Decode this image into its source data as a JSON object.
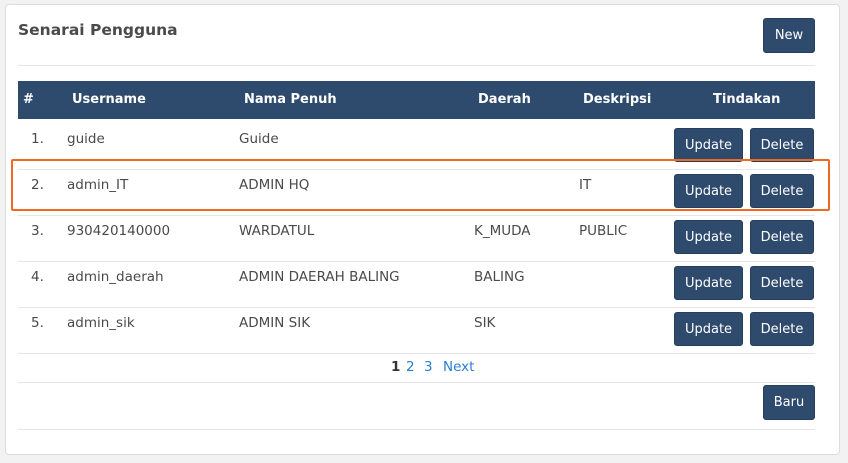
{
  "page": {
    "title": "Senarai Pengguna",
    "new_label": "New",
    "baru_label": "Baru"
  },
  "table": {
    "headers": [
      "#",
      "Username",
      "Nama Penuh",
      "Daerah",
      "Deskripsi",
      "Tindakan"
    ],
    "rows": [
      {
        "no": "1.",
        "username": "guide",
        "nama": "Guide",
        "daerah": "",
        "deskripsi": ""
      },
      {
        "no": "2.",
        "username": "admin_IT",
        "nama": "ADMIN HQ",
        "daerah": "",
        "deskripsi": "IT"
      },
      {
        "no": "3.",
        "username": "930420140000",
        "nama": "WARDATUL",
        "daerah": "K_MUDA",
        "deskripsi": "PUBLIC"
      },
      {
        "no": "4.",
        "username": "admin_daerah",
        "nama": "ADMIN DAERAH BALING",
        "daerah": "BALING",
        "deskripsi": ""
      },
      {
        "no": "5.",
        "username": "admin_sik",
        "nama": "ADMIN SIK",
        "daerah": "SIK",
        "deskripsi": ""
      }
    ],
    "update_label": "Update",
    "delete_label": "Delete"
  },
  "pagination": {
    "current": "1",
    "pages": [
      "2",
      "3"
    ],
    "next_label": "Next"
  },
  "colors": {
    "header_bg": "#2e4a6c",
    "button_bg": "#2e4a6c",
    "highlight": "#ee6a1f",
    "link": "#2a7ed3"
  }
}
